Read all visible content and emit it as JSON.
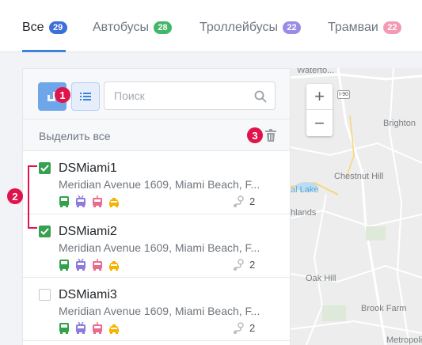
{
  "tabs": [
    {
      "label": "Все",
      "count": "29",
      "color": "#3d6fd9",
      "active": true
    },
    {
      "label": "Автобусы",
      "count": "28",
      "color": "#42b76a",
      "active": false
    },
    {
      "label": "Троллейбусы",
      "count": "22",
      "color": "#9a8be6",
      "active": false
    },
    {
      "label": "Трамваи",
      "count": "22",
      "color": "#f29ab3",
      "active": false
    }
  ],
  "search": {
    "placeholder": "Поиск"
  },
  "select_all_label": "Выделить все",
  "items": [
    {
      "name": "DSMiami1",
      "address": "Meridian Avenue 1609, Miami Beach, F...",
      "routes": "2",
      "checked": true
    },
    {
      "name": "DSMiami2",
      "address": "Meridian Avenue 1609, Miami Beach, F...",
      "routes": "2",
      "checked": true
    },
    {
      "name": "DSMiami3",
      "address": "Meridian Avenue 1609, Miami Beach, F...",
      "routes": "2",
      "checked": false
    }
  ],
  "transport_icons": [
    {
      "name": "bus-icon",
      "color": "#2fa24a"
    },
    {
      "name": "trolleybus-icon",
      "color": "#8b7be0"
    },
    {
      "name": "tram-icon",
      "color": "#e96a91"
    },
    {
      "name": "taxi-icon",
      "color": "#f5b400"
    }
  ],
  "map": {
    "zoom_in": "+",
    "zoom_out": "−",
    "route_badge": "I-90",
    "labels": [
      "Waterto...",
      "Brighton",
      "Chestnut Hill",
      "al Lake",
      "hlands",
      "Oak Hill",
      "Brook Farm",
      "Metropoli"
    ]
  },
  "markers": [
    "1",
    "2",
    "3"
  ],
  "colors": {
    "accent": "#3d84d9",
    "checked": "#37a152",
    "marker": "#e0144c"
  }
}
